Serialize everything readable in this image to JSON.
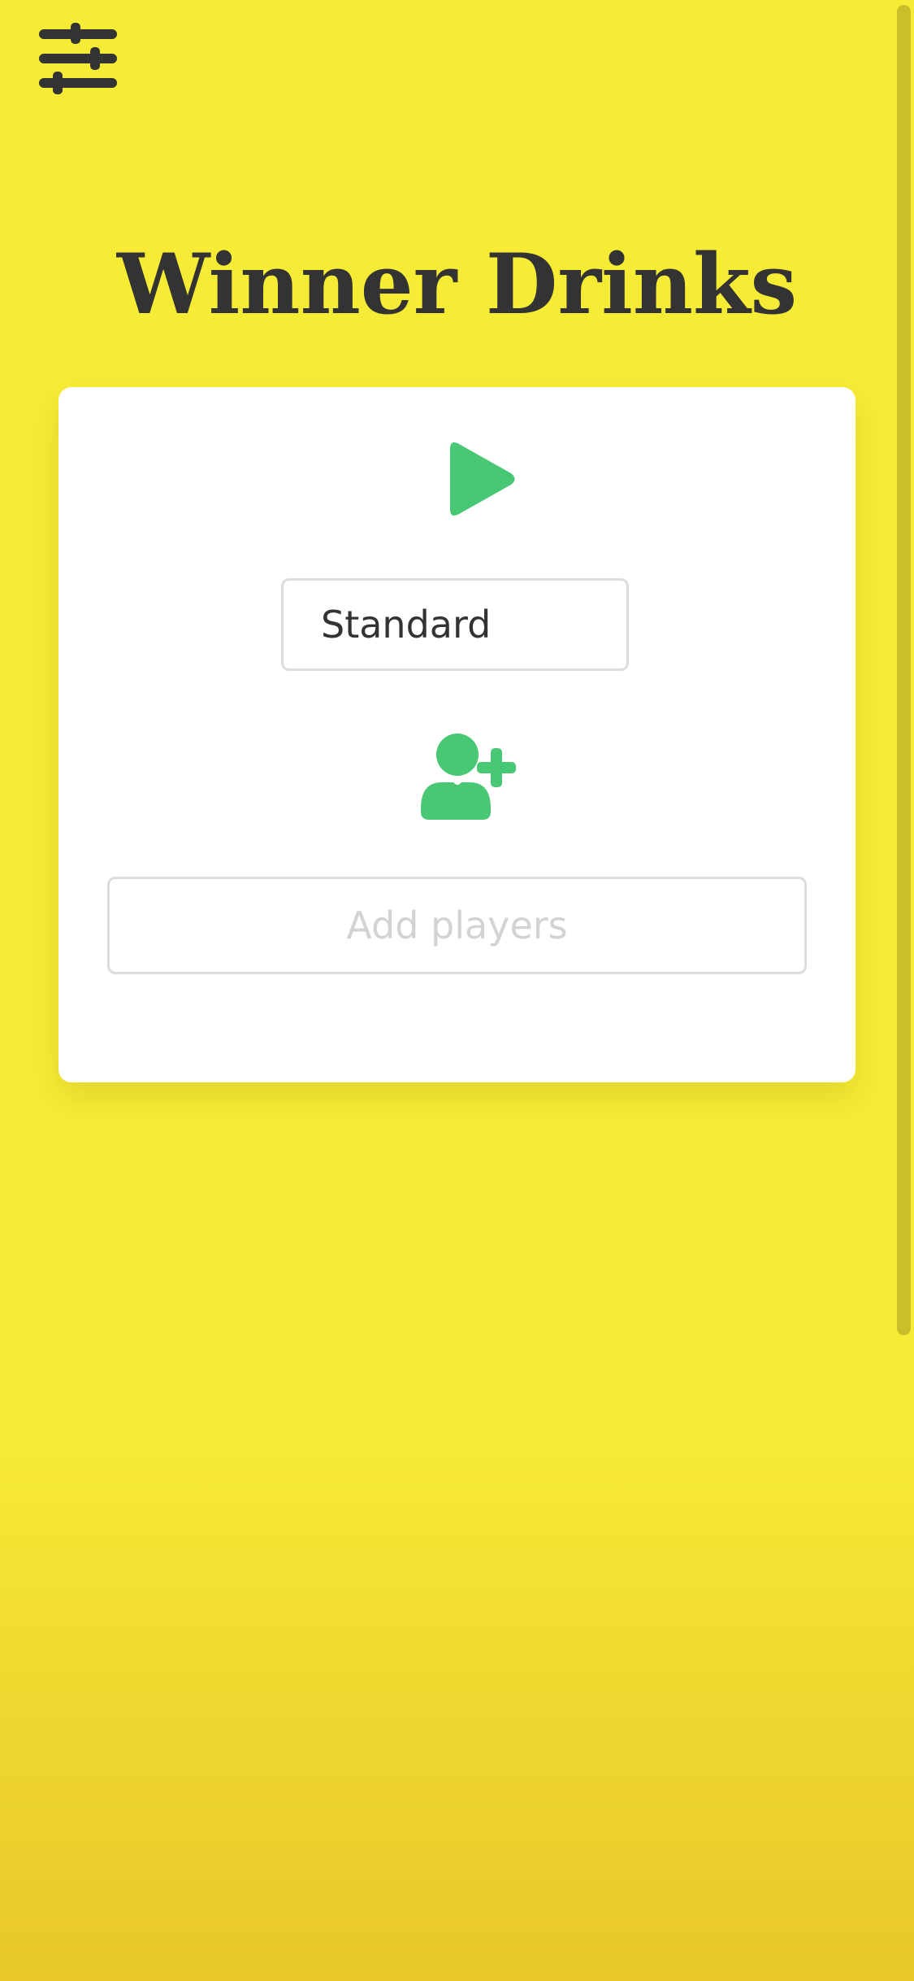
{
  "header": {
    "settings_icon": "sliders-icon"
  },
  "main": {
    "title": "Winner Drinks"
  },
  "card": {
    "play_icon": "play-icon",
    "mode": {
      "selected": "Standard"
    },
    "add_player_icon": "user-plus-icon",
    "players_input": {
      "value": "",
      "placeholder": "Add players"
    }
  },
  "colors": {
    "background": "#f7ec35",
    "accent": "#48c774",
    "text": "#333333",
    "card": "#ffffff"
  }
}
